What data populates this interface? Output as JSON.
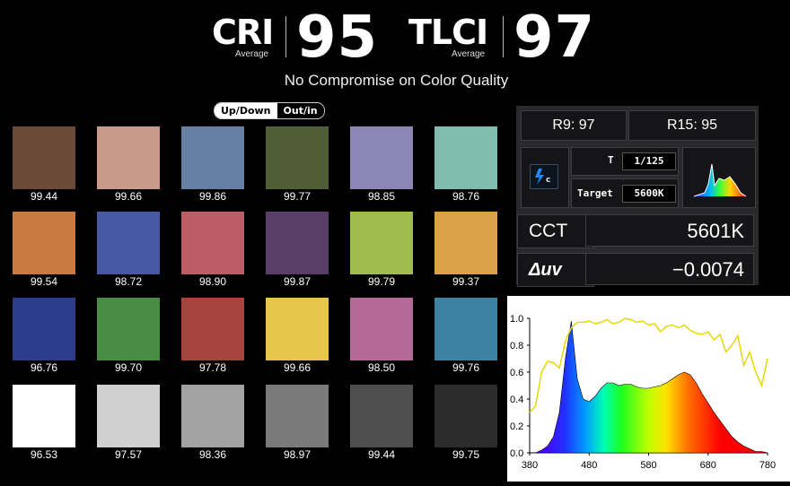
{
  "header": {
    "cri": {
      "label": "CRI",
      "sub": "Average",
      "value": "95"
    },
    "tlci": {
      "label": "TLCI",
      "sub": "Average",
      "value": "97"
    },
    "tagline": "No Compromise on Color Quality"
  },
  "toggle": {
    "up_down": "Up/Down",
    "out_in": "Out/in",
    "active": "out_in"
  },
  "swatches": [
    {
      "color": "#6b4a3a",
      "value": "99.44"
    },
    {
      "color": "#c99a88",
      "value": "99.66"
    },
    {
      "color": "#6580a2",
      "value": "99.86"
    },
    {
      "color": "#4f5e34",
      "value": "99.77"
    },
    {
      "color": "#8b86b6",
      "value": "98.85"
    },
    {
      "color": "#7ebcb0",
      "value": "98.76"
    },
    {
      "color": "#c97a40",
      "value": "99.54"
    },
    {
      "color": "#4859a4",
      "value": "98.72"
    },
    {
      "color": "#bc5c64",
      "value": "98.90"
    },
    {
      "color": "#583e68",
      "value": "99.87"
    },
    {
      "color": "#9fbc4c",
      "value": "99.79"
    },
    {
      "color": "#d9a148",
      "value": "99.37"
    },
    {
      "color": "#2e3c8c",
      "value": "96.76"
    },
    {
      "color": "#4a8c46",
      "value": "99.70"
    },
    {
      "color": "#a8423c",
      "value": "97.78"
    },
    {
      "color": "#e7c64e",
      "value": "99.66"
    },
    {
      "color": "#b46996",
      "value": "98.50"
    },
    {
      "color": "#3e82a2",
      "value": "99.76"
    },
    {
      "color": "#ffffff",
      "value": "96.53"
    },
    {
      "color": "#d0d0d0",
      "value": "97.57"
    },
    {
      "color": "#a2a2a2",
      "value": "98.36"
    },
    {
      "color": "#7a7a7a",
      "value": "98.97"
    },
    {
      "color": "#4e4e4e",
      "value": "99.44"
    },
    {
      "color": "#2c2c2c",
      "value": "99.75"
    }
  ],
  "meter": {
    "r9": "R9: 97",
    "r15": "R15: 95",
    "mode_icon": "flash-c-icon",
    "t_label": "T",
    "t_value": "1/125",
    "target_label": "Target",
    "target_value": "5600K",
    "cct_label": "CCT",
    "cct_value": "5601K",
    "duv_label": "Δuv",
    "duv_value": "−0.0074"
  },
  "chart_data": {
    "type": "line",
    "x": [
      380,
      390,
      400,
      410,
      420,
      430,
      440,
      450,
      460,
      470,
      480,
      490,
      500,
      510,
      520,
      530,
      540,
      550,
      560,
      570,
      580,
      590,
      600,
      610,
      620,
      630,
      640,
      650,
      660,
      670,
      680,
      690,
      700,
      710,
      720,
      730,
      740,
      750,
      760,
      770,
      780
    ],
    "series": [
      {
        "values": [
          0.0,
          0.0,
          0.02,
          0.05,
          0.12,
          0.3,
          0.7,
          0.98,
          0.55,
          0.4,
          0.38,
          0.42,
          0.48,
          0.52,
          0.52,
          0.5,
          0.51,
          0.51,
          0.49,
          0.48,
          0.48,
          0.49,
          0.5,
          0.52,
          0.55,
          0.58,
          0.6,
          0.58,
          0.52,
          0.44,
          0.37,
          0.3,
          0.24,
          0.18,
          0.12,
          0.08,
          0.05,
          0.03,
          0.01,
          0.01,
          0.0
        ],
        "color": "spectrum"
      },
      {
        "values": [
          0.3,
          0.35,
          0.6,
          0.68,
          0.67,
          0.63,
          0.83,
          0.93,
          0.97,
          0.97,
          0.98,
          0.96,
          0.97,
          0.99,
          0.96,
          0.97,
          1.0,
          0.99,
          0.97,
          0.98,
          0.95,
          0.96,
          0.9,
          0.94,
          0.95,
          0.93,
          0.95,
          0.91,
          0.89,
          0.88,
          0.9,
          0.84,
          0.88,
          0.75,
          0.8,
          0.87,
          0.65,
          0.75,
          0.6,
          0.5,
          0.7
        ],
        "color": "#e6d800"
      }
    ],
    "xlim": [
      380,
      780
    ],
    "ylim": [
      0,
      1.0
    ],
    "x_ticks": [
      "380",
      "480",
      "580",
      "680",
      "780"
    ],
    "y_ticks": [
      "0.0",
      "0.2",
      "0.4",
      "0.6",
      "0.8",
      "1.0"
    ]
  }
}
